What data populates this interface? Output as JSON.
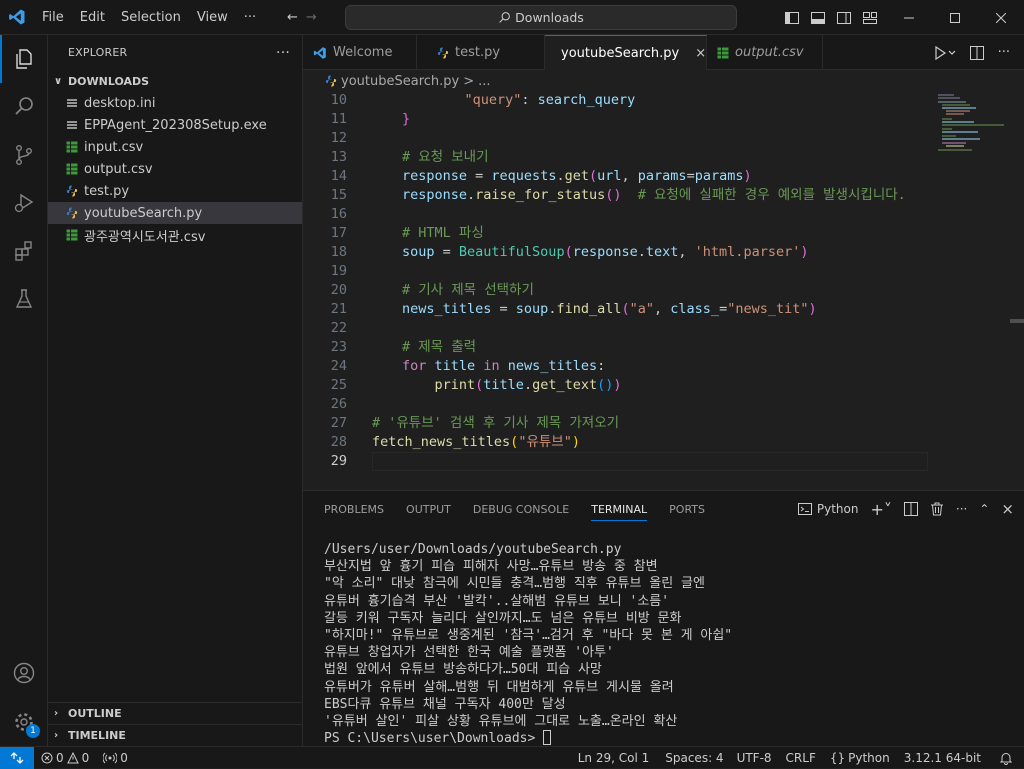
{
  "titlebar": {
    "menu": [
      "File",
      "Edit",
      "Selection",
      "View",
      "···"
    ],
    "search": "Downloads"
  },
  "explorer": {
    "title": "EXPLORER",
    "more": "···",
    "section": "DOWNLOADS",
    "files": [
      {
        "name": "desktop.ini",
        "type": "ini"
      },
      {
        "name": "EPPAgent_202308Setup.exe",
        "type": "exe"
      },
      {
        "name": "input.csv",
        "type": "csv"
      },
      {
        "name": "output.csv",
        "type": "csv"
      },
      {
        "name": "test.py",
        "type": "py"
      },
      {
        "name": "youtubeSearch.py",
        "type": "py",
        "selected": true
      },
      {
        "name": "광주광역시도서관.csv",
        "type": "csv"
      }
    ],
    "outline": "OUTLINE",
    "timeline": "TIMELINE"
  },
  "tabs": [
    {
      "label": "Welcome",
      "icon": "vscode-icon"
    },
    {
      "label": "test.py",
      "icon": "python-icon"
    },
    {
      "label": "youtubeSearch.py",
      "icon": "python-icon",
      "active": true
    },
    {
      "label": "output.csv",
      "icon": "csv-icon"
    }
  ],
  "breadcrumb": {
    "file": "youtubeSearch.py",
    "sep": ">",
    "more": "..."
  },
  "editor": {
    "line_numbers": [
      "10",
      "11",
      "12",
      "13",
      "14",
      "15",
      "16",
      "17",
      "18",
      "19",
      "20",
      "21",
      "22",
      "23",
      "24",
      "25",
      "26",
      "27",
      "28",
      "29"
    ],
    "current_line": "29"
  },
  "panel": {
    "tabs": [
      "PROBLEMS",
      "OUTPUT",
      "DEBUG CONSOLE",
      "TERMINAL",
      "PORTS"
    ],
    "active_tab": "TERMINAL",
    "shell": "Python",
    "terminal_lines": [
      "/Users/user/Downloads/youtubeSearch.py",
      "부산지법 앞 흉기 피습 피해자 사망…유튜브 방송 중 참변",
      "\"악 소리\" 대낮 참극에 시민들 충격…범행 직후 유튜브 올린 글엔",
      "유튜버 흉기습격 부산 '발칵'..살해범 유튜브 보니 '소름'",
      "갈등 키워 구독자 늘리다 살인까지…도 넘은 유튜브 비방 문화",
      "\"하지마!\" 유튜브로 생중계된 '참극'…검거 후 \"바다 못 본 게 아쉽\"",
      "유튜브 창업자가 선택한 한국 예술 플랫폼 '아투'",
      "법원 앞에서 유튜브 방송하다가…50대 피습 사망",
      "유튜버가 유튜버 살해…범행 뒤 대범하게 유튜브 게시물 올려",
      "EBS다큐 유튜브 채널 구독자 400만 달성",
      "'유튜버 살인' 피살 상황 유튜브에 그대로 노출…온라인 확산"
    ],
    "prompt": "PS C:\\Users\\user\\Downloads> "
  },
  "statusbar": {
    "errors": "0",
    "warnings": "0",
    "ports": "0",
    "position": "Ln 29, Col 1",
    "spaces": "Spaces: 4",
    "encoding": "UTF-8",
    "eol": "CRLF",
    "language": "Python",
    "interpreter": "3.12.1 64-bit",
    "accounts_badge": "1"
  },
  "colors": {
    "accent": "#0078d4",
    "background": "#1f1f1f",
    "sidebar": "#181818"
  }
}
